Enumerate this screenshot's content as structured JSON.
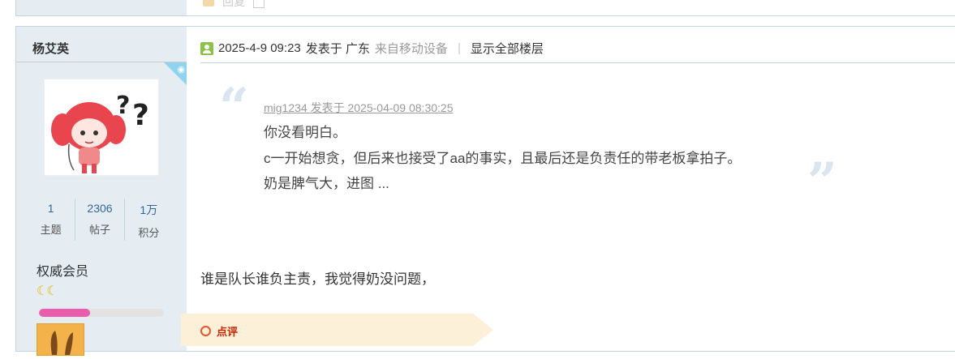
{
  "previous_post": {
    "actions": [
      "回复"
    ]
  },
  "author": {
    "name": "杨艾英",
    "stats": [
      {
        "value": "1",
        "label": "主题"
      },
      {
        "value": "2306",
        "label": "帖子"
      },
      {
        "value": "1万",
        "label": "积分"
      }
    ],
    "group": "权威会员",
    "stars": "☾☾",
    "level_progress_percent": 41
  },
  "post": {
    "datetime": "2025-4-9 09:23",
    "posted_in": "发表于 广东",
    "from_device": "来自移动设备",
    "separator": "|",
    "show_all_floors": "显示全部楼层",
    "quote": {
      "header": "mig1234 发表于 2025-04-09 08:30:25",
      "lines": [
        "你没看明白。",
        "c一开始想贪，但后来也接受了aa的事实，且最后还是负责任的带老板拿拍子。",
        "奶是脾气大，进图 ..."
      ]
    },
    "reply": "谁是队长谁负主责，我觉得奶没问题，",
    "comment_label": "点评"
  },
  "colors": {
    "sidebar_bg": "#e5edf2",
    "border": "#c2d5e3",
    "link_blue": "#336699",
    "comment_red": "#cc2200",
    "progress_pink": "#e95dab"
  }
}
